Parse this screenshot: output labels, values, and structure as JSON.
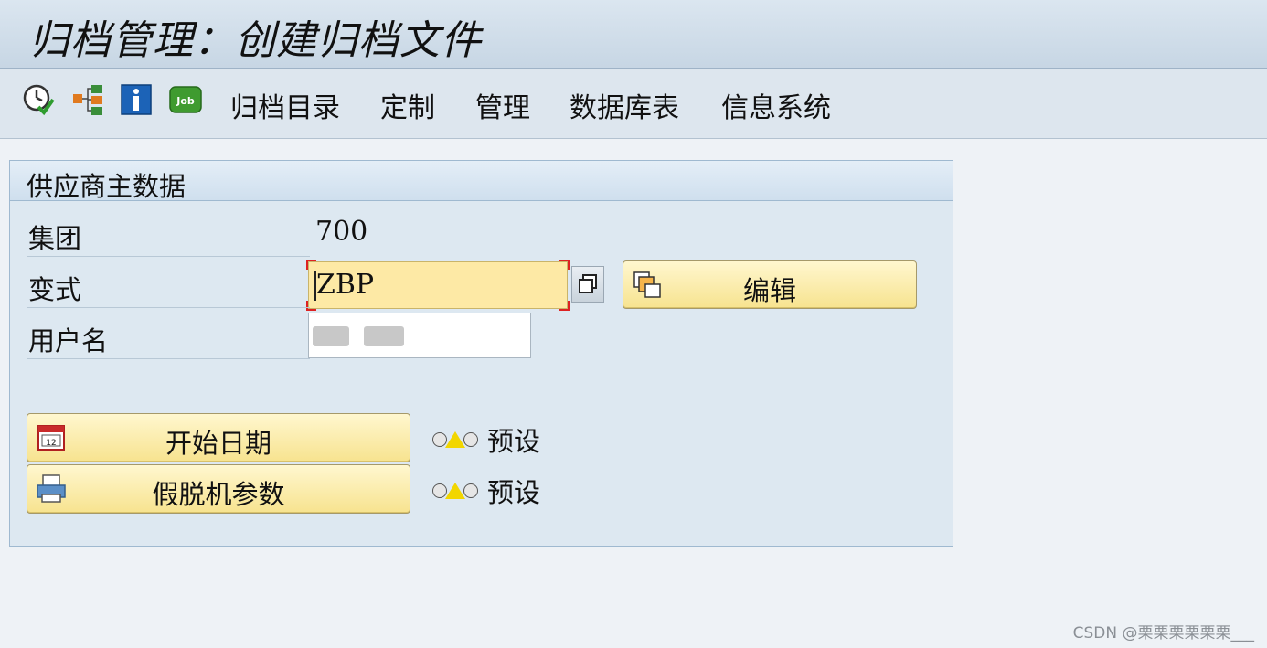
{
  "window": {
    "title": "归档管理：创建归档文件"
  },
  "toolbar": {
    "icons": [
      "execute-clock-icon",
      "hierarchy-icon",
      "info-icon",
      "job-icon"
    ],
    "job_icon_text": "Job",
    "menu": [
      "归档目录",
      "定制",
      "管理",
      "数据库表",
      "信息系统"
    ]
  },
  "panel": {
    "title": "供应商主数据",
    "client": {
      "label": "集团",
      "value": "700"
    },
    "variant": {
      "label": "变式",
      "value": "ZBP"
    },
    "username": {
      "label": "用户名",
      "value": ""
    },
    "edit_button": "编辑",
    "start_date_button": "开始日期",
    "spool_params_button": "假脱机参数",
    "start_date_status": "预设",
    "spool_status": "预设"
  },
  "watermark": "CSDN @栗栗栗栗栗栗___"
}
